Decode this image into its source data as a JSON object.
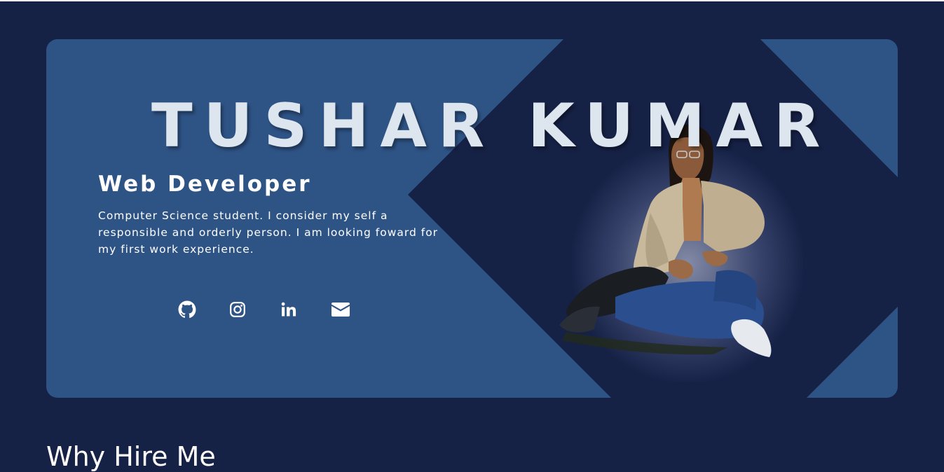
{
  "hero": {
    "name": "TUSHAR KUMAR",
    "role": "Web Developer",
    "bio": "Computer Science student. I consider my self a responsible and orderly person. I am looking foward for my first work experience.",
    "socials": [
      {
        "icon": "github-icon"
      },
      {
        "icon": "instagram-icon"
      },
      {
        "icon": "linkedin-icon"
      },
      {
        "icon": "envelope-icon"
      }
    ],
    "photo_alt": "portrait-photo"
  },
  "next_section": {
    "heading": "Why Hire Me"
  },
  "colors": {
    "page_bg": "#162146",
    "card_bg": "#2e5385",
    "dark_panel": "#162146",
    "name_text": "#dde5ef",
    "text": "#ffffff"
  }
}
